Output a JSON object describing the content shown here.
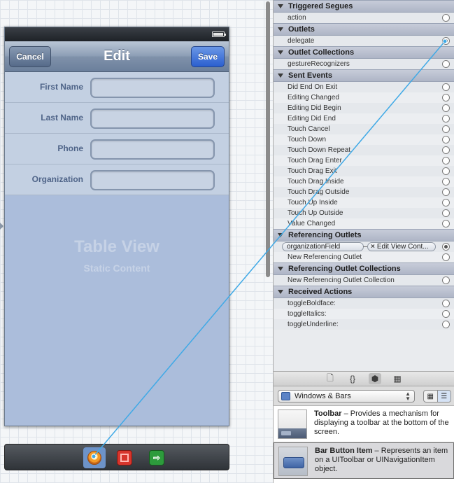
{
  "scene": {
    "nav_title": "Edit",
    "cancel_label": "Cancel",
    "save_label": "Save",
    "form_labels": [
      "First Name",
      "Last Name",
      "Phone",
      "Organization"
    ],
    "table_title": "Table View",
    "table_subtitle": "Static Content"
  },
  "inspector": {
    "sections": [
      {
        "title": "Triggered Segues",
        "rows": [
          {
            "label": "action",
            "connected": false
          }
        ]
      },
      {
        "title": "Outlets",
        "rows": [
          {
            "label": "delegate",
            "connected": true
          }
        ]
      },
      {
        "title": "Outlet Collections",
        "rows": [
          {
            "label": "gestureRecognizers",
            "connected": false
          }
        ]
      },
      {
        "title": "Sent Events",
        "rows": [
          {
            "label": "Did End On Exit",
            "connected": false
          },
          {
            "label": "Editing Changed",
            "connected": false
          },
          {
            "label": "Editing Did Begin",
            "connected": false
          },
          {
            "label": "Editing Did End",
            "connected": false
          },
          {
            "label": "Touch Cancel",
            "connected": false
          },
          {
            "label": "Touch Down",
            "connected": false
          },
          {
            "label": "Touch Down Repeat",
            "connected": false
          },
          {
            "label": "Touch Drag Enter",
            "connected": false
          },
          {
            "label": "Touch Drag Exit",
            "connected": false
          },
          {
            "label": "Touch Drag Inside",
            "connected": false
          },
          {
            "label": "Touch Drag Outside",
            "connected": false
          },
          {
            "label": "Touch Up Inside",
            "connected": false
          },
          {
            "label": "Touch Up Outside",
            "connected": false
          },
          {
            "label": "Value Changed",
            "connected": false
          }
        ]
      },
      {
        "title": "Referencing Outlets",
        "referencing": {
          "outlet": "organizationField",
          "target": "Edit View Cont..."
        },
        "rows": [
          {
            "label": "New Referencing Outlet",
            "connected": false
          }
        ]
      },
      {
        "title": "Referencing Outlet Collections",
        "rows": [
          {
            "label": "New Referencing Outlet Collection",
            "connected": false
          }
        ]
      },
      {
        "title": "Received Actions",
        "rows": [
          {
            "label": "toggleBoldface:",
            "connected": false
          },
          {
            "label": "toggleItalics:",
            "connected": false
          },
          {
            "label": "toggleUnderline:",
            "connected": false
          }
        ]
      }
    ]
  },
  "library": {
    "tabs": [
      "file-icon",
      "braces-icon",
      "cube-icon",
      "grid-icon"
    ],
    "tab_glyphs": [
      "🗋",
      "{}",
      "⬢",
      "▦"
    ],
    "category": "Windows & Bars",
    "items": [
      {
        "name": "Toolbar",
        "desc": " – Provides a mechanism for displaying a toolbar at the bottom of the screen."
      },
      {
        "name": "Bar Button Item",
        "desc": " – Represents an item on a UIToolbar or UINavigationItem object."
      }
    ]
  },
  "colors": {
    "connection_line": "#3fa9e6",
    "nav_bar": "#8e9fb6",
    "save_button": "#2b5fcf"
  }
}
